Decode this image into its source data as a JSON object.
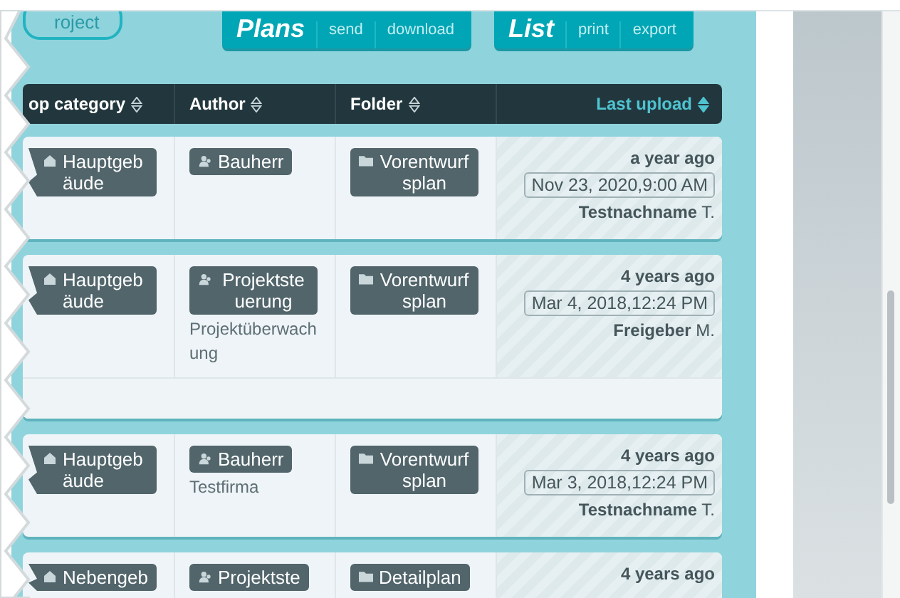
{
  "project_button": {
    "label": "roject"
  },
  "toolbar_groups": [
    {
      "title": "Plans",
      "actions": [
        "send",
        "download"
      ]
    },
    {
      "title": "List",
      "actions": [
        "print",
        "export"
      ]
    }
  ],
  "table": {
    "columns": [
      {
        "label": "op category",
        "selected": false
      },
      {
        "label": "Author",
        "selected": false
      },
      {
        "label": "Folder",
        "selected": false
      },
      {
        "label": "Last upload",
        "selected": true
      }
    ],
    "rows": [
      {
        "category": "Hauptgebäude",
        "author": "Bauherr",
        "author_note": "",
        "folder": "Vorentwurfsplan",
        "relative": "a year ago",
        "date": "Nov 23, 2020,9:00 AM",
        "uploader": "**Testnachname** T.",
        "expanded": false
      },
      {
        "category": "Hauptgebäude",
        "author": "Projektsteuerung",
        "author_note": "Projektüberwachung",
        "folder": "Vorentwurfsplan",
        "relative": "4 years ago",
        "date": "Mar 4, 2018,12:24 PM",
        "uploader": "**Freigeber** M.",
        "expanded": true
      },
      {
        "category": "Hauptgebäude",
        "author": "Bauherr",
        "author_note": "Testfirma",
        "folder": "Vorentwurfsplan",
        "relative": "4 years ago",
        "date": "Mar 3, 2018,12:24 PM",
        "uploader": "**Testnachname** T.",
        "expanded": false
      },
      {
        "category": "Nebengeb",
        "author": "Projektste",
        "author_note": "",
        "folder": "Detailplan",
        "relative": "4 years ago",
        "date": "",
        "uploader": "",
        "expanded": false
      }
    ]
  }
}
